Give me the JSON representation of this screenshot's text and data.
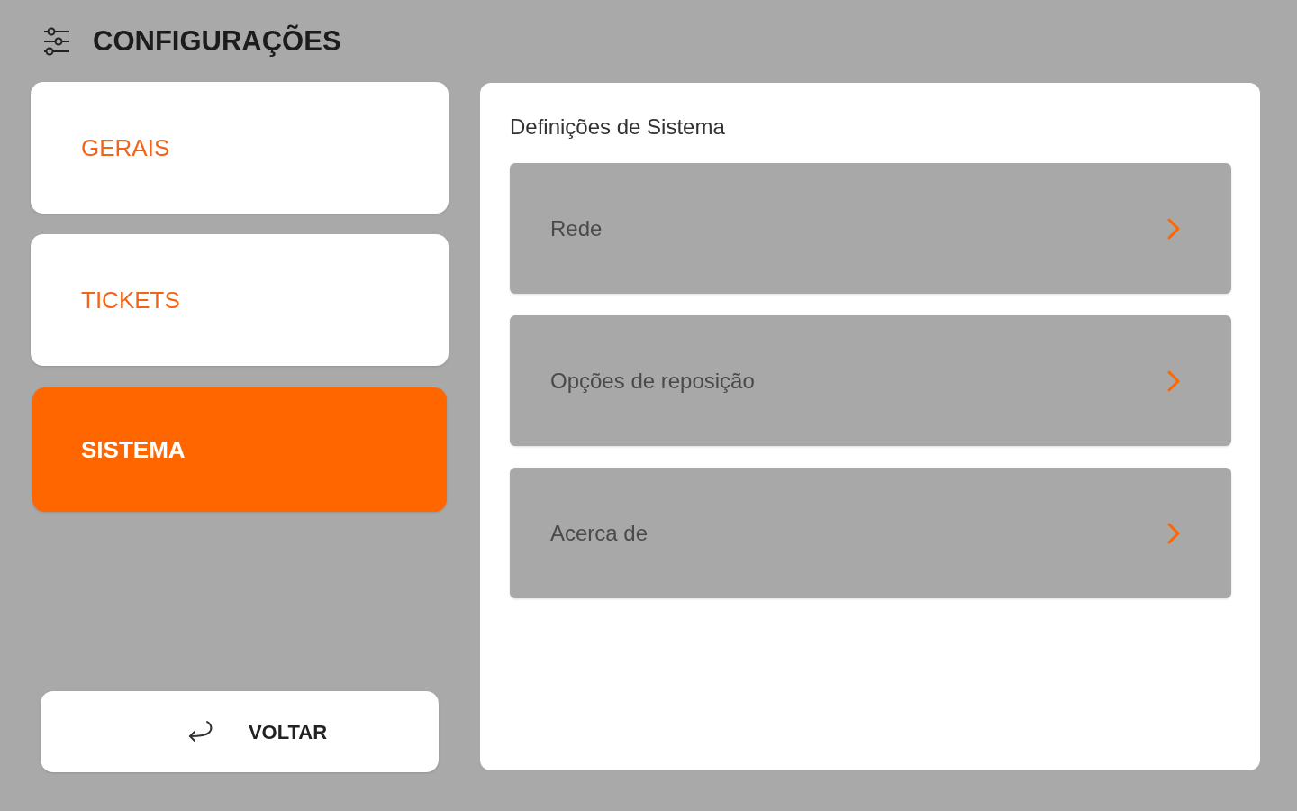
{
  "header": {
    "title": "CONFIGURAÇÕES"
  },
  "tabs": [
    {
      "label": "GERAIS",
      "selected": false
    },
    {
      "label": "TICKETS",
      "selected": false
    },
    {
      "label": "SISTEMA",
      "selected": true
    }
  ],
  "back_button": {
    "label": "VOLTAR"
  },
  "panel": {
    "title": "Definições de Sistema",
    "items": [
      {
        "label": "Rede"
      },
      {
        "label": "Opções de reposição"
      },
      {
        "label": "Acerca de"
      }
    ]
  }
}
